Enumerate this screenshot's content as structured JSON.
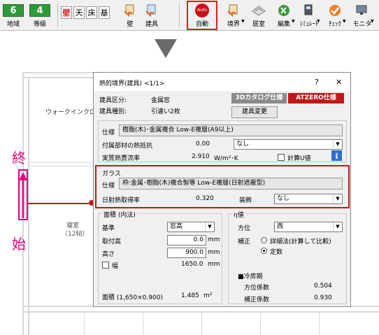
{
  "toolbar": {
    "num1": "6",
    "num1_label": "地域",
    "num2": "4",
    "num2_label": "等級",
    "k1": "壁",
    "k2": "天",
    "k3": "床",
    "k4": "基",
    "b_wall": "壁",
    "b_fixture": "建具",
    "b_auto_badge": "Auto",
    "b_auto": "自動",
    "b_boundary": "境界",
    "b_room": "居室",
    "b_edit": "編集",
    "b_sim": "ｼﾐｭﾚｰﾄ",
    "b_check": "ﾁｪｯｸ",
    "b_monitor": "モニタ"
  },
  "plan": {
    "closet_label": "ウォークインクローゼ",
    "bedroom_label": "寝室",
    "bedroom_sub": "（12帖）",
    "end_label": "終",
    "start_label": "始"
  },
  "dialog": {
    "title": "熱的境界(建具)  <1/1>",
    "help": "?",
    "close": "✕",
    "kubun_label": "建具区分:",
    "kubun_value": "金属窓",
    "shubetsu_label": "建具種別:",
    "shubetsu_value": "引違い2枚",
    "tab_3d": "3Dカタログ仕様",
    "tab_atzero": "ATZERO仕様",
    "change_button": "建具変更",
    "spec_label": "仕様",
    "spec_value": "樹脂(木)･金属複合 Low-E複層(A9以上)",
    "fuzoku_label": "付属部材の熱抵抗",
    "fuzoku_value": "0.00",
    "fuzoku_select": "なし",
    "netsu_label": "実質熱貫流率",
    "netsu_value": "2.910",
    "netsu_unit": "W/m²･K",
    "keisan_u": "計算U値",
    "glass_group": "ガラス",
    "glass_spec_label": "仕様",
    "glass_spec_value": "枠:金属･樹脂(木)複合製等 Low-E複層(日射遮蔽型)",
    "nissha_label": "日射熱取得率",
    "nissha_value": "0.320",
    "soshoku_label": "装飾",
    "soshoku_value": "なし",
    "area_group": "面積 (内法)",
    "kijun_label": "基準",
    "kijun_value": "窓高",
    "toritsuke_label": "取付高",
    "toritsuke_value": "0.0",
    "takasa_label": "高さ",
    "takasa_value": "900.0",
    "mm1": "mm",
    "mm2": "mm",
    "mm3": "mm",
    "haba_label": "幅",
    "haba_value": "1650.0",
    "menseki_label": "面積 (1,650×0.900)",
    "menseki_value": "1.485",
    "menseki_unit": "m²",
    "eta_group": "η値",
    "hoi_label": "方位",
    "hoi_value": "西",
    "hosei_label": "補正",
    "hosei_opt1": "詳細法(計算して比較)",
    "hosei_opt2": "定数",
    "reibou_label": "■冷房期",
    "hoi_keisu_label": "方位係数",
    "hoi_keisu_value": "0.504",
    "hosei_keisu_label": "補正係数",
    "hosei_keisu_value": "0.930"
  },
  "colors": {
    "accent_red": "#d81e1e",
    "magenta": "#e6007e",
    "teal_tab": "#7a7a7a"
  }
}
